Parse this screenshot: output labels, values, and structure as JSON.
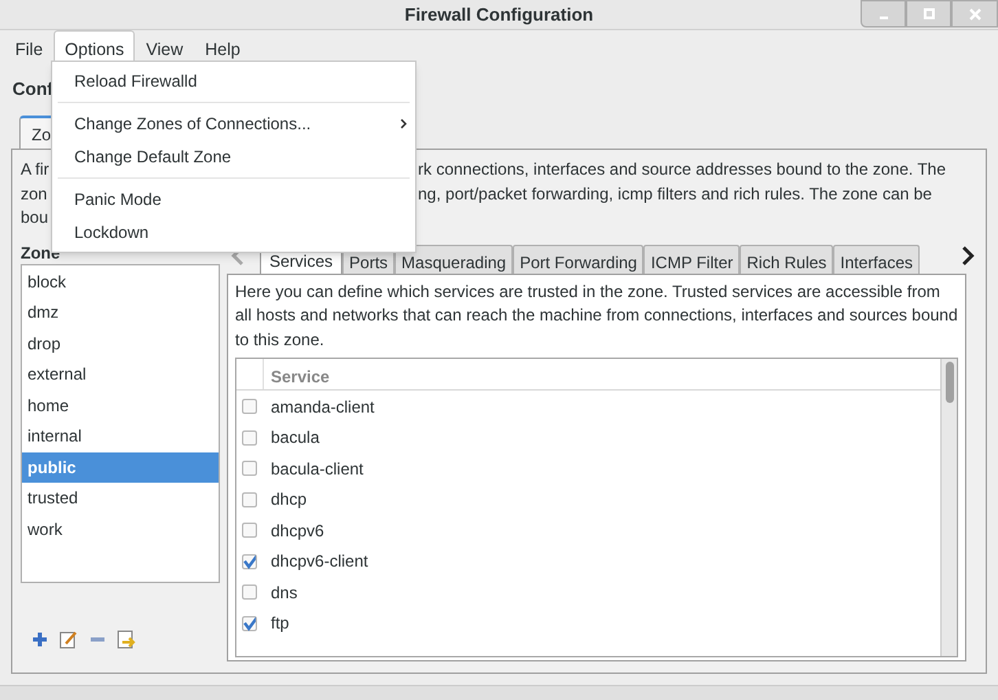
{
  "window": {
    "title": "Firewall Configuration"
  },
  "menu_bar": [
    {
      "label": "File",
      "selected": false
    },
    {
      "label": "Options",
      "selected": true
    },
    {
      "label": "View",
      "selected": false
    },
    {
      "label": "Help",
      "selected": false
    }
  ],
  "options_menu": [
    {
      "kind": "item",
      "label": "Reload Firewalld"
    },
    {
      "kind": "separator"
    },
    {
      "kind": "submenu",
      "label": "Change Zones of Connections..."
    },
    {
      "kind": "item",
      "label": "Change Default Zone"
    },
    {
      "kind": "separator"
    },
    {
      "kind": "item",
      "label": "Panic Mode"
    },
    {
      "kind": "item",
      "label": "Lockdown"
    }
  ],
  "heading": "Conf",
  "main_tab": "Zo",
  "description": [
    {
      "left": "A fir",
      "right": "rk connections, interfaces and source addresses bound to the zone. The"
    },
    {
      "left": "zon",
      "right": "ng, port/packet forwarding, icmp filters and rich rules. The zone can be"
    },
    {
      "left": "bou"
    }
  ],
  "zone_panel": {
    "label": "Zone",
    "items": [
      {
        "label": "block",
        "selected": false
      },
      {
        "label": "dmz",
        "selected": false
      },
      {
        "label": "drop",
        "selected": false
      },
      {
        "label": "external",
        "selected": false
      },
      {
        "label": "home",
        "selected": false
      },
      {
        "label": "internal",
        "selected": false
      },
      {
        "label": "public",
        "selected": true
      },
      {
        "label": "trusted",
        "selected": false
      },
      {
        "label": "work",
        "selected": false
      }
    ]
  },
  "zone_tabs": [
    {
      "label": "Services",
      "selected": true
    },
    {
      "label": "Ports",
      "selected": false
    },
    {
      "label": "Masquerading",
      "selected": false
    },
    {
      "label": "Port Forwarding",
      "selected": false
    },
    {
      "label": "ICMP Filter",
      "selected": false
    },
    {
      "label": "Rich Rules",
      "selected": false
    },
    {
      "label": "Interfaces",
      "selected": false
    }
  ],
  "services_description": "Here you can define which services are trusted in the zone. Trusted services are accessible from all hosts and networks that can reach the machine from connections, interfaces and sources bound to this zone.",
  "services_table": {
    "columns": [
      "Service"
    ],
    "rows": [
      {
        "name": "amanda-client",
        "checked": false
      },
      {
        "name": "bacula",
        "checked": false
      },
      {
        "name": "bacula-client",
        "checked": false
      },
      {
        "name": "dhcp",
        "checked": false
      },
      {
        "name": "dhcpv6",
        "checked": false
      },
      {
        "name": "dhcpv6-client",
        "checked": true
      },
      {
        "name": "dns",
        "checked": false
      },
      {
        "name": "ftp",
        "checked": true
      }
    ]
  }
}
